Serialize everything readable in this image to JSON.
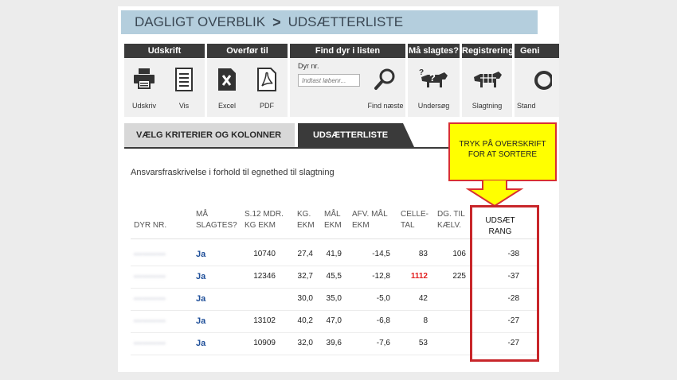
{
  "breadcrumb": {
    "first": "DAGLIGT OVERBLIK",
    "separator": ">",
    "current": "UDSÆTTERLISTE"
  },
  "toolbar": {
    "groups": [
      {
        "title": "Udskrift",
        "tools": [
          {
            "label": "Udskriv",
            "icon": "printer-icon"
          },
          {
            "label": "Vis",
            "icon": "document-icon"
          }
        ]
      },
      {
        "title": "Overfør til",
        "tools": [
          {
            "label": "Excel",
            "icon": "excel-icon"
          },
          {
            "label": "PDF",
            "icon": "pdf-icon"
          }
        ]
      },
      {
        "title": "Find dyr i listen",
        "field_label": "Dyr nr.",
        "placeholder": "Indtast løbenr...",
        "find_label": "Find næste",
        "icon": "magnifier-icon"
      },
      {
        "title": "Må slagtes?",
        "tools": [
          {
            "label": "Undersøg",
            "icon": "cow-question-icon"
          }
        ]
      },
      {
        "title": "Registrering",
        "tools": [
          {
            "label": "Slagtning",
            "icon": "cow-cuts-icon"
          }
        ]
      },
      {
        "title": "Geni",
        "tools": [
          {
            "label": "Stand",
            "icon": "partial-icon"
          }
        ]
      }
    ]
  },
  "tabs": {
    "inactive": "VÆLG KRITERIER OG KOLONNER",
    "active": "UDSÆTTERLISTE"
  },
  "disclaimer": "Ansvarsfraskrivelse i forhold til egnethed til slagtning",
  "table": {
    "headers": {
      "dyr": "DYR NR.",
      "maa_1": "MÅ",
      "maa_2": "SLAGTES?",
      "s12_1": "S.12 MDR.",
      "s12_2": "KG EKM",
      "kg_1": "KG.",
      "kg_2": "EKM",
      "maal_1": "MÅL",
      "maal_2": "EKM",
      "afv_1": "AFV. MÅL",
      "afv_2": "EKM",
      "celle_1": "CELLE-",
      "celle_2": "TAL",
      "dg_1": "DG. TIL",
      "dg_2": "KÆLV.",
      "rang_1": "UDSÆT",
      "rang_2": "RANG"
    },
    "rows": [
      {
        "dyr": "•••••••••••",
        "maa": "Ja",
        "s12": "10740",
        "kg": "27,4",
        "maal": "41,9",
        "afv": "-14,5",
        "celle": "83",
        "dg": "106",
        "rang": "-38",
        "celle_alert": false
      },
      {
        "dyr": "•••••••••••",
        "maa": "Ja",
        "s12": "12346",
        "kg": "32,7",
        "maal": "45,5",
        "afv": "-12,8",
        "celle": "1112",
        "dg": "225",
        "rang": "-37",
        "celle_alert": true
      },
      {
        "dyr": "•••••••••••",
        "maa": "Ja",
        "s12": "",
        "kg": "30,0",
        "maal": "35,0",
        "afv": "-5,0",
        "celle": "42",
        "dg": "",
        "rang": "-28",
        "celle_alert": false
      },
      {
        "dyr": "•••••••••••",
        "maa": "Ja",
        "s12": "13102",
        "kg": "40,2",
        "maal": "47,0",
        "afv": "-6,8",
        "celle": "8",
        "dg": "",
        "rang": "-27",
        "celle_alert": false
      },
      {
        "dyr": "•••••••••••",
        "maa": "Ja",
        "s12": "10909",
        "kg": "32,0",
        "maal": "39,6",
        "afv": "-7,6",
        "celle": "53",
        "dg": "",
        "rang": "-27",
        "celle_alert": false
      }
    ]
  },
  "callout": {
    "line1": "TRYK PÅ OVERSKRIFT",
    "line2": "FOR AT SORTERE"
  },
  "colors": {
    "breadcrumb_bg": "#b4cedd",
    "toolbar_dark": "#3a3a3a",
    "link_blue": "#1f4f99",
    "alert_red": "#e32020",
    "callout_yellow": "#ffff00",
    "highlight_red": "#c8262a"
  }
}
